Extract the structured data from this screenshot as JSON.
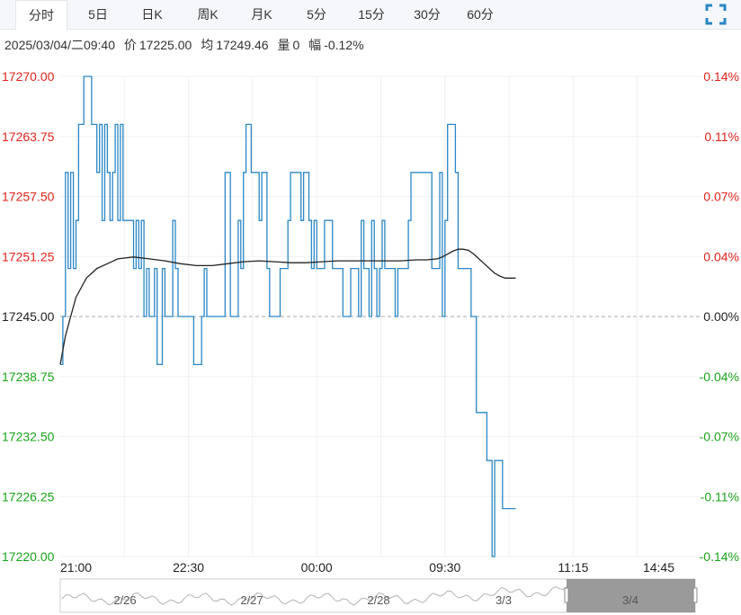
{
  "tabs": [
    {
      "label": "分时",
      "active": true
    },
    {
      "label": "5日",
      "active": false
    },
    {
      "label": "日K",
      "active": false
    },
    {
      "label": "周K",
      "active": false
    },
    {
      "label": "月K",
      "active": false
    },
    {
      "label": "5分",
      "active": false
    },
    {
      "label": "15分",
      "active": false
    },
    {
      "label": "30分",
      "active": false
    },
    {
      "label": "60分",
      "active": false
    }
  ],
  "fullscreen_icon": "expand-icon",
  "info": {
    "datetime": "2025/03/04/二09:40",
    "price_label": "价",
    "price": "17225.00",
    "avg_label": "均",
    "avg": "17249.46",
    "volume_label": "量",
    "volume": "0",
    "change_label": "幅",
    "change": "-0.12%"
  },
  "colors": {
    "price_line": "#2a87c6",
    "avg_line": "#222222",
    "up": "#e0231c",
    "down": "#1aa31a",
    "neutral": "#222222",
    "grid": "#eef0f3",
    "baseline": "#aaaaaa",
    "navigator_mask": "#888888"
  },
  "chart_data": {
    "type": "line",
    "prev_close": 17245.0,
    "ylim": [
      17220.0,
      17270.0
    ],
    "y_ticks_left": [
      "17270.00",
      "17263.75",
      "17257.50",
      "17251.25",
      "17245.00",
      "17238.75",
      "17232.50",
      "17226.25",
      "17220.00"
    ],
    "y_ticks_right": [
      "0.14%",
      "0.11%",
      "0.07%",
      "0.04%",
      "0.00%",
      "-0.04%",
      "-0.07%",
      "-0.11%",
      "-0.14%"
    ],
    "x_ticks": [
      "21:00",
      "22:30",
      "00:00",
      "09:30",
      "11:15",
      "14:45"
    ],
    "xlim": [
      0,
      245
    ],
    "series": [
      {
        "key": "price",
        "x": [
          0,
          1,
          2,
          3,
          4,
          5,
          6,
          7,
          8,
          9,
          10,
          11,
          12,
          13,
          14,
          15,
          16,
          17,
          18,
          19,
          20,
          21,
          22,
          23,
          24,
          25,
          26,
          27,
          28,
          29,
          30,
          31,
          32,
          33,
          34,
          35,
          36,
          37,
          38,
          39,
          40,
          41,
          42,
          43,
          44,
          45,
          46,
          47,
          48,
          49,
          50,
          51,
          52,
          53,
          54,
          55,
          56,
          57,
          58,
          59,
          60,
          61,
          62,
          63,
          64,
          65,
          66,
          67,
          68,
          69,
          70,
          71,
          72,
          73,
          74,
          75,
          76,
          77,
          78,
          79,
          80,
          81,
          82,
          83,
          84,
          85,
          86,
          87,
          88,
          89,
          90,
          91,
          92,
          93,
          94,
          95,
          96,
          97,
          98,
          99,
          100,
          101,
          102,
          103,
          104,
          105,
          106,
          107,
          108,
          109,
          110,
          111,
          112,
          113,
          114,
          115,
          116,
          117,
          118,
          119,
          120,
          121,
          122,
          123,
          124,
          125,
          126,
          127,
          128,
          129,
          130,
          131,
          132,
          133,
          134,
          135,
          136,
          137,
          138,
          139,
          140,
          141,
          142,
          143,
          144,
          145,
          146,
          147,
          148,
          149,
          150,
          151,
          152,
          153,
          154,
          155,
          156,
          157,
          158,
          159,
          160,
          161,
          162,
          163,
          164,
          165,
          166,
          167,
          168,
          169,
          170,
          171,
          172,
          173,
          174
        ],
        "values": [
          17240,
          17245,
          17260,
          17250,
          17260,
          17250,
          17255,
          17265,
          17265,
          17270,
          17270,
          17270,
          17265,
          17265,
          17260,
          17265,
          17255,
          17265,
          17260,
          17255,
          17260,
          17265,
          17255,
          17265,
          17255,
          17255,
          17255,
          17255,
          17250,
          17255,
          17250,
          17255,
          17245,
          17250,
          17245,
          17245,
          17250,
          17240,
          17240,
          17250,
          17245,
          17245,
          17245,
          17255,
          17250,
          17245,
          17245,
          17245,
          17245,
          17245,
          17245,
          17240,
          17240,
          17240,
          17245,
          17250,
          17245,
          17245,
          17245,
          17245,
          17245,
          17245,
          17245,
          17260,
          17260,
          17245,
          17245,
          17245,
          17255,
          17250,
          17260,
          17265,
          17265,
          17260,
          17260,
          17260,
          17255,
          17260,
          17260,
          17250,
          17245,
          17245,
          17245,
          17245,
          17250,
          17250,
          17250,
          17255,
          17260,
          17260,
          17260,
          17260,
          17255,
          17260,
          17260,
          17255,
          17250,
          17255,
          17250,
          17250,
          17250,
          17255,
          17255,
          17255,
          17250,
          17250,
          17250,
          17250,
          17245,
          17245,
          17245,
          17250,
          17250,
          17250,
          17245,
          17255,
          17250,
          17250,
          17245,
          17255,
          17250,
          17245,
          17250,
          17255,
          17250,
          17250,
          17250,
          17250,
          17245,
          17250,
          17250,
          17250,
          17250,
          17255,
          17260,
          17260,
          17260,
          17260,
          17260,
          17260,
          17260,
          17260,
          17250,
          17250,
          17250,
          17260,
          17245,
          17255,
          17265,
          17265,
          17265,
          17260,
          17250,
          17250,
          17250,
          17250,
          17250,
          17245,
          17245,
          17235,
          17235,
          17235,
          17235,
          17230,
          17230,
          17220,
          17230,
          17230,
          17230,
          17225,
          17225,
          17225,
          17225,
          17225,
          17225
        ]
      },
      {
        "key": "average",
        "x": [
          0,
          2,
          4,
          6,
          8,
          10,
          14,
          18,
          22,
          28,
          34,
          40,
          46,
          52,
          58,
          64,
          70,
          76,
          82,
          88,
          94,
          100,
          106,
          112,
          118,
          124,
          130,
          136,
          140,
          144,
          146,
          148,
          150,
          152,
          154,
          156,
          158,
          160,
          162,
          164,
          166,
          168,
          170,
          172,
          174
        ],
        "values": [
          17240,
          17243,
          17245,
          17247,
          17248,
          17249,
          17250,
          17250.5,
          17251,
          17251.2,
          17251,
          17250.8,
          17250.5,
          17250.3,
          17250.3,
          17250.5,
          17250.7,
          17250.8,
          17250.7,
          17250.6,
          17250.6,
          17250.7,
          17250.8,
          17250.8,
          17250.8,
          17250.8,
          17250.8,
          17250.9,
          17250.9,
          17251,
          17251.2,
          17251.5,
          17251.8,
          17252,
          17252,
          17251.9,
          17251.5,
          17251,
          17250.5,
          17250,
          17249.5,
          17249.2,
          17249,
          17249,
          17249
        ]
      }
    ],
    "navigator": {
      "labels": [
        "2/26",
        "2/27",
        "2/28",
        "3/3",
        "3/4"
      ]
    },
    "grid": true
  }
}
